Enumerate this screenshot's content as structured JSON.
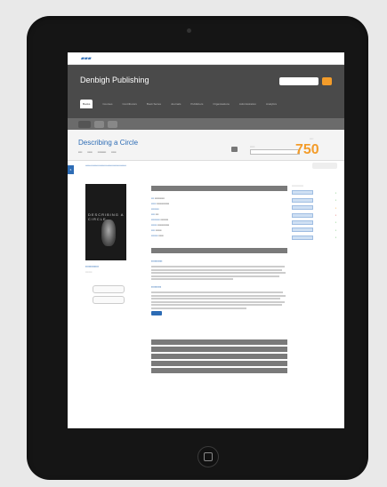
{
  "header": {
    "brand": "Denbigh Publishing",
    "nav_items": [
      "Books",
      "Courses",
      "Contributors",
      "Book Series",
      "Journals",
      "Publishers",
      "Organisations",
      "Administration",
      "Analytics"
    ],
    "active_nav": "Books"
  },
  "document": {
    "title": "Describing a Circle",
    "score": "750"
  },
  "sidebar_tab": {
    "label": "6"
  },
  "book": {
    "cover_text": "DESCRIBING A CIRCLE"
  },
  "colors": {
    "accent": "#f39c2a",
    "link": "#2d6cb5",
    "header": "#4a4a4a"
  }
}
